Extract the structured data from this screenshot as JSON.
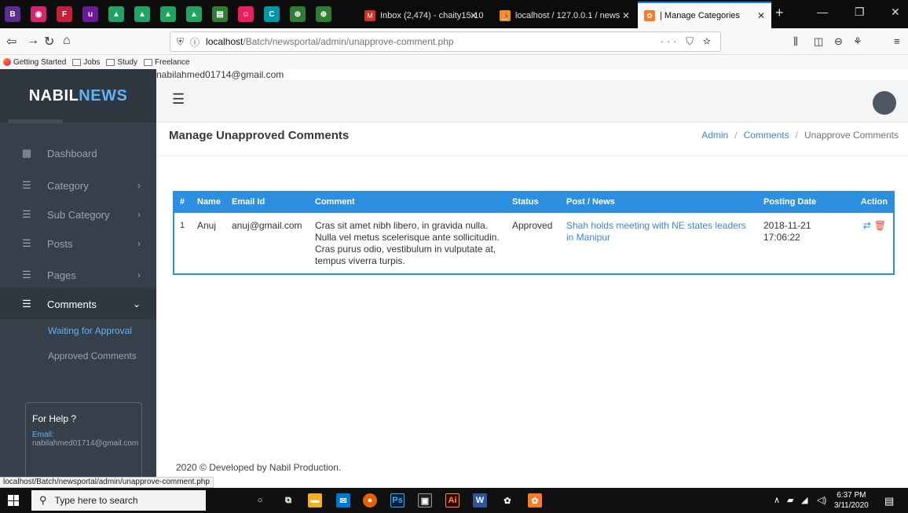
{
  "browser": {
    "pinned_tabs": [
      {
        "icon": "b-app-icon",
        "glyph": "B",
        "color": "#5c2d91"
      },
      {
        "icon": "pink-app-icon",
        "glyph": "◉",
        "color": "#d6246e"
      },
      {
        "icon": "red-app-icon",
        "glyph": "F",
        "color": "#c41e3a"
      },
      {
        "icon": "u-app-icon",
        "glyph": "u",
        "color": "#6a1b9a"
      },
      {
        "icon": "drive-icon",
        "glyph": "▲",
        "color": "#1fa463"
      },
      {
        "icon": "drive-icon",
        "glyph": "▲",
        "color": "#1fa463"
      },
      {
        "icon": "drive-icon",
        "glyph": "▲",
        "color": "#1fa463"
      },
      {
        "icon": "drive-icon",
        "glyph": "▲",
        "color": "#1fa463"
      },
      {
        "icon": "chart-app-icon",
        "glyph": "▤",
        "color": "#2e7d32"
      },
      {
        "icon": "pink-face-icon",
        "glyph": "☺",
        "color": "#e91e63"
      },
      {
        "icon": "c-app-icon",
        "glyph": "C",
        "color": "#0097a7"
      },
      {
        "icon": "green-app-icon",
        "glyph": "⊕",
        "color": "#2e7d32"
      },
      {
        "icon": "green-app-icon",
        "glyph": "⊕",
        "color": "#2e7d32"
      }
    ],
    "tabs": [
      {
        "label": "Inbox (2,474) - chaity15-100",
        "icon": "gmail-icon",
        "fav_color": "#d93025",
        "glyph": "M"
      },
      {
        "label": "localhost / 127.0.0.1 / news",
        "icon": "phpmyadmin-icon",
        "fav_color": "#f29111",
        "glyph": "⛵"
      },
      {
        "label": "| Manage Categories",
        "icon": "xampp-icon",
        "fav_color": "#fb7a24",
        "glyph": "✿"
      }
    ],
    "url_host": "localhost",
    "url_path": "/Batch/newsportal/admin/unapprove-comment.php",
    "bookmarks": [
      "Getting Started",
      "Jobs",
      "Study",
      "Freelance"
    ],
    "status_url": "localhost/Batch/newsportal/admin/unapprove-comment.php"
  },
  "sidebar": {
    "logo_part1": "NABIL",
    "logo_part2": "NEWS",
    "items": [
      {
        "label": "Dashboard",
        "icon": "dashboard-icon",
        "has_chevron": false
      },
      {
        "label": "Category",
        "icon": "list-icon",
        "has_chevron": true
      },
      {
        "label": "Sub Category",
        "icon": "list-icon",
        "has_chevron": true
      },
      {
        "label": "Posts",
        "icon": "list-icon",
        "has_chevron": true
      },
      {
        "label": "Pages",
        "icon": "list-icon",
        "has_chevron": true
      },
      {
        "label": "Comments",
        "icon": "list-icon",
        "has_chevron": true
      }
    ],
    "submenu": [
      "Waiting for Approval",
      "Approved Comments"
    ],
    "help": {
      "title": "For Help ?",
      "email_label": "Email:",
      "email": "nabilahmed01714@gmail.com"
    }
  },
  "header": {
    "user_email": "nabilahmed01714@gmail.com"
  },
  "main": {
    "title": "Manage Unapproved Comments",
    "breadcrumb": [
      "Admin",
      "Comments",
      "Unapprove Comments"
    ],
    "table": {
      "headers": [
        "#",
        "Name",
        "Email Id",
        "Comment",
        "Status",
        "Post / News",
        "Posting Date",
        "Action"
      ],
      "rows": [
        {
          "num": "1",
          "name": "Anuj",
          "email": "anuj@gmail.com",
          "comment": "Cras sit amet nibh libero, in gravida nulla. Nulla vel metus scelerisque ante sollicitudin. Cras purus odio, vestibulum in vulputate at, tempus viverra turpis.",
          "status": "Approved",
          "post": "Shah holds meeting with NE states leaders in Manipur",
          "date": "2018-11-21 17:06:22"
        }
      ]
    }
  },
  "footer": {
    "text": "2020 © Developed by Nabil Production."
  },
  "taskbar": {
    "search_placeholder": "Type here to search",
    "time": "6:37 PM",
    "date": "3/11/2020"
  }
}
